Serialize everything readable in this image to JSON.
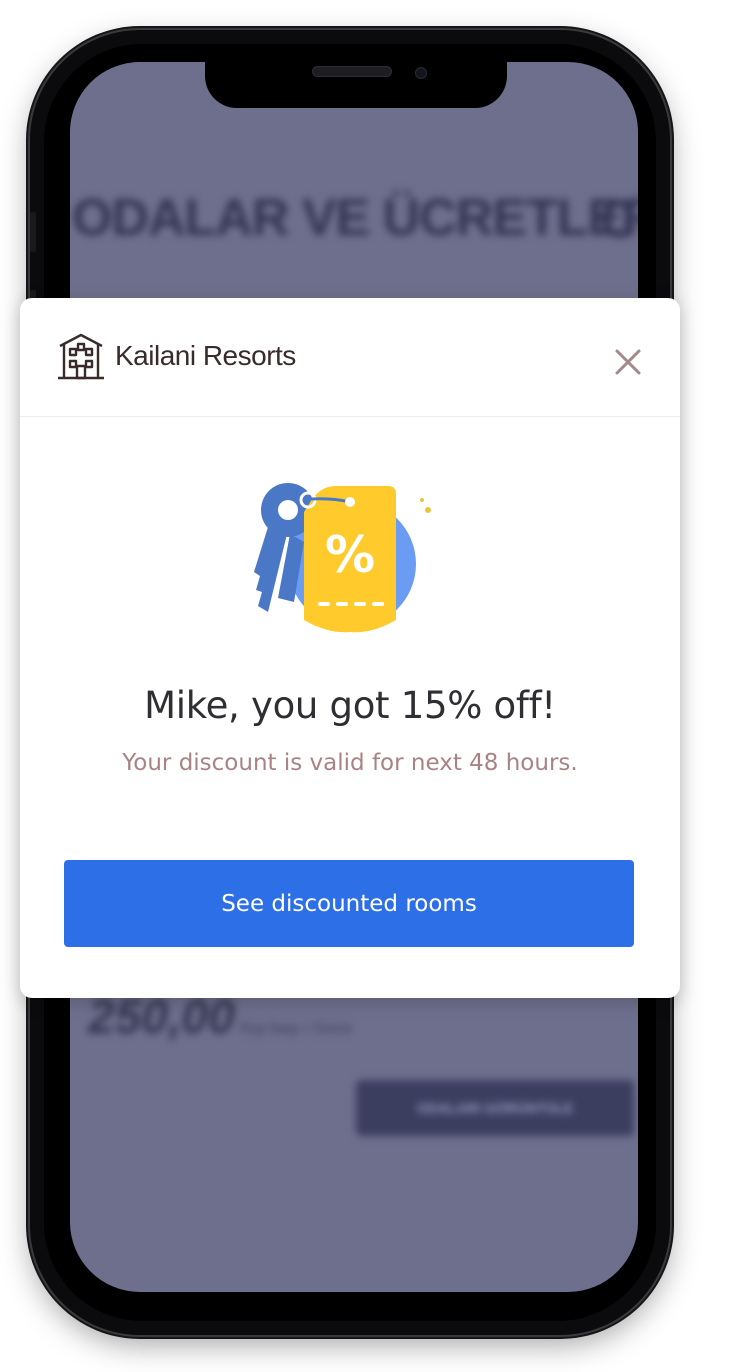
{
  "background_page": {
    "title": "ODALAR VE ÜCRETLER",
    "title_cut": "C",
    "price": "250,00",
    "price_note": "Kişi başı / Gece",
    "button_label": "ODALARI GÖRÜNTÜLE"
  },
  "modal": {
    "brand": {
      "icon": "hotel-building-icon",
      "name": "Kailani Resorts"
    },
    "close_icon": "close-icon",
    "illustration_icon": "discount-tag-with-keys-icon",
    "headline": "Mike, you got 15% off!",
    "subline": "Your discount is valid for next 48 hours.",
    "cta_label": "See discounted rooms"
  },
  "colors": {
    "cta": "#2d6fe6",
    "headline": "#2f2f33",
    "subline": "#a98383",
    "tag_yellow": "#ffca2c",
    "key_blue": "#4a78c7",
    "circle_blue": "#6b9cf4",
    "screen_overlay": "#6d6f8d"
  }
}
